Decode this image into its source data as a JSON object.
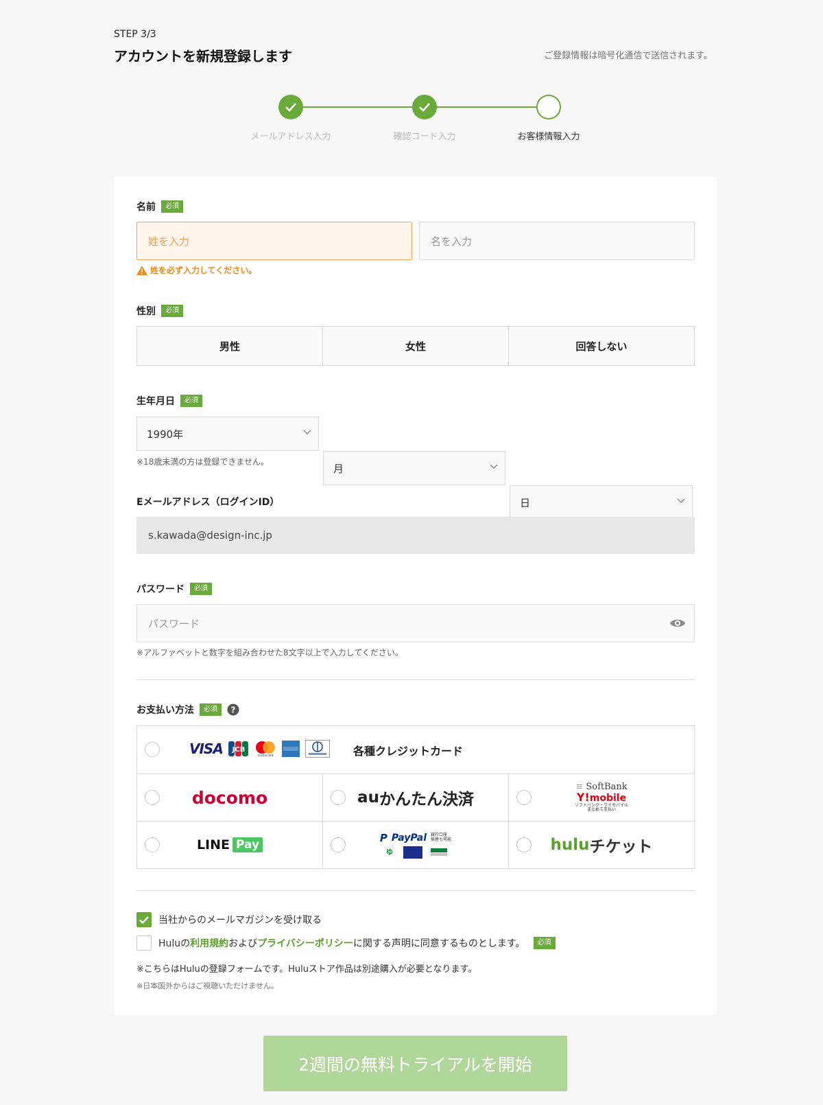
{
  "header": {
    "step": "STEP 3/3",
    "title": "アカウントを新規登録します",
    "secure_note": "ご登録情報は暗号化通信で送信されます。"
  },
  "steps": [
    {
      "label": "メールアドレス入力",
      "status": "done"
    },
    {
      "label": "確認コード入力",
      "status": "done"
    },
    {
      "label": "お客様情報入力",
      "status": "current"
    }
  ],
  "required_badge": "必須",
  "name": {
    "label": "名前",
    "last_placeholder": "姓を入力",
    "first_placeholder": "名を入力",
    "error": "姓を必ず入力してください。"
  },
  "gender": {
    "label": "性別",
    "options": [
      "男性",
      "女性",
      "回答しない"
    ]
  },
  "birthday": {
    "label": "生年月日",
    "year": "1990年",
    "month": "月",
    "day": "日",
    "note": "※18歳未満の方は登録できません。"
  },
  "email": {
    "label": "Eメールアドレス（ログインID）",
    "value": "s.kawada@design-inc.jp"
  },
  "password": {
    "label": "パスワード",
    "placeholder": "パスワード",
    "note": "※アルファベットと数字を組み合わせた8文字以上で入力してください。"
  },
  "payment": {
    "label": "お支払い方法",
    "credit": {
      "brands": [
        "VISA",
        "JCB",
        "mastercard",
        "AMERICAN EXPRESS",
        "Diners Club"
      ],
      "label": "各種クレジットカード"
    },
    "docomo": "docomo",
    "au": {
      "au": "au",
      "text": "かんたん決済"
    },
    "softbank": {
      "top": "SoftBank",
      "ymobile_y": "Y!",
      "ymobile": "mobile",
      "sub": "ソフトバンク・ワイモバイル",
      "sub2": "まとめて支払い"
    },
    "line": {
      "line": "LINE",
      "pay": "Pay"
    },
    "paypal": {
      "name": "PayPal",
      "bank": "銀行口座",
      "bank2": "振替も可能"
    },
    "hulu": {
      "hulu": "hulu",
      "ticket": "チケット"
    }
  },
  "checkboxes": {
    "newsletter": "当社からのメールマガジンを受け取る",
    "terms_pre": "Huluの",
    "terms_link1": "利用規約",
    "terms_mid": "および",
    "terms_link2": "プライバシーポリシー",
    "terms_post": "に関する声明に同意するものとします。"
  },
  "notes": {
    "form_note": "※こちらはHuluの登録フォームです。Huluストア作品は別途購入が必要となります。",
    "region_note": "※日本国外からはご視聴いただけません。"
  },
  "submit": "2週間の無料トライアルを開始",
  "colors": {
    "accent": "#6aaa3a",
    "error": "#f08a1c",
    "submit_disabled": "#b1d69a"
  }
}
